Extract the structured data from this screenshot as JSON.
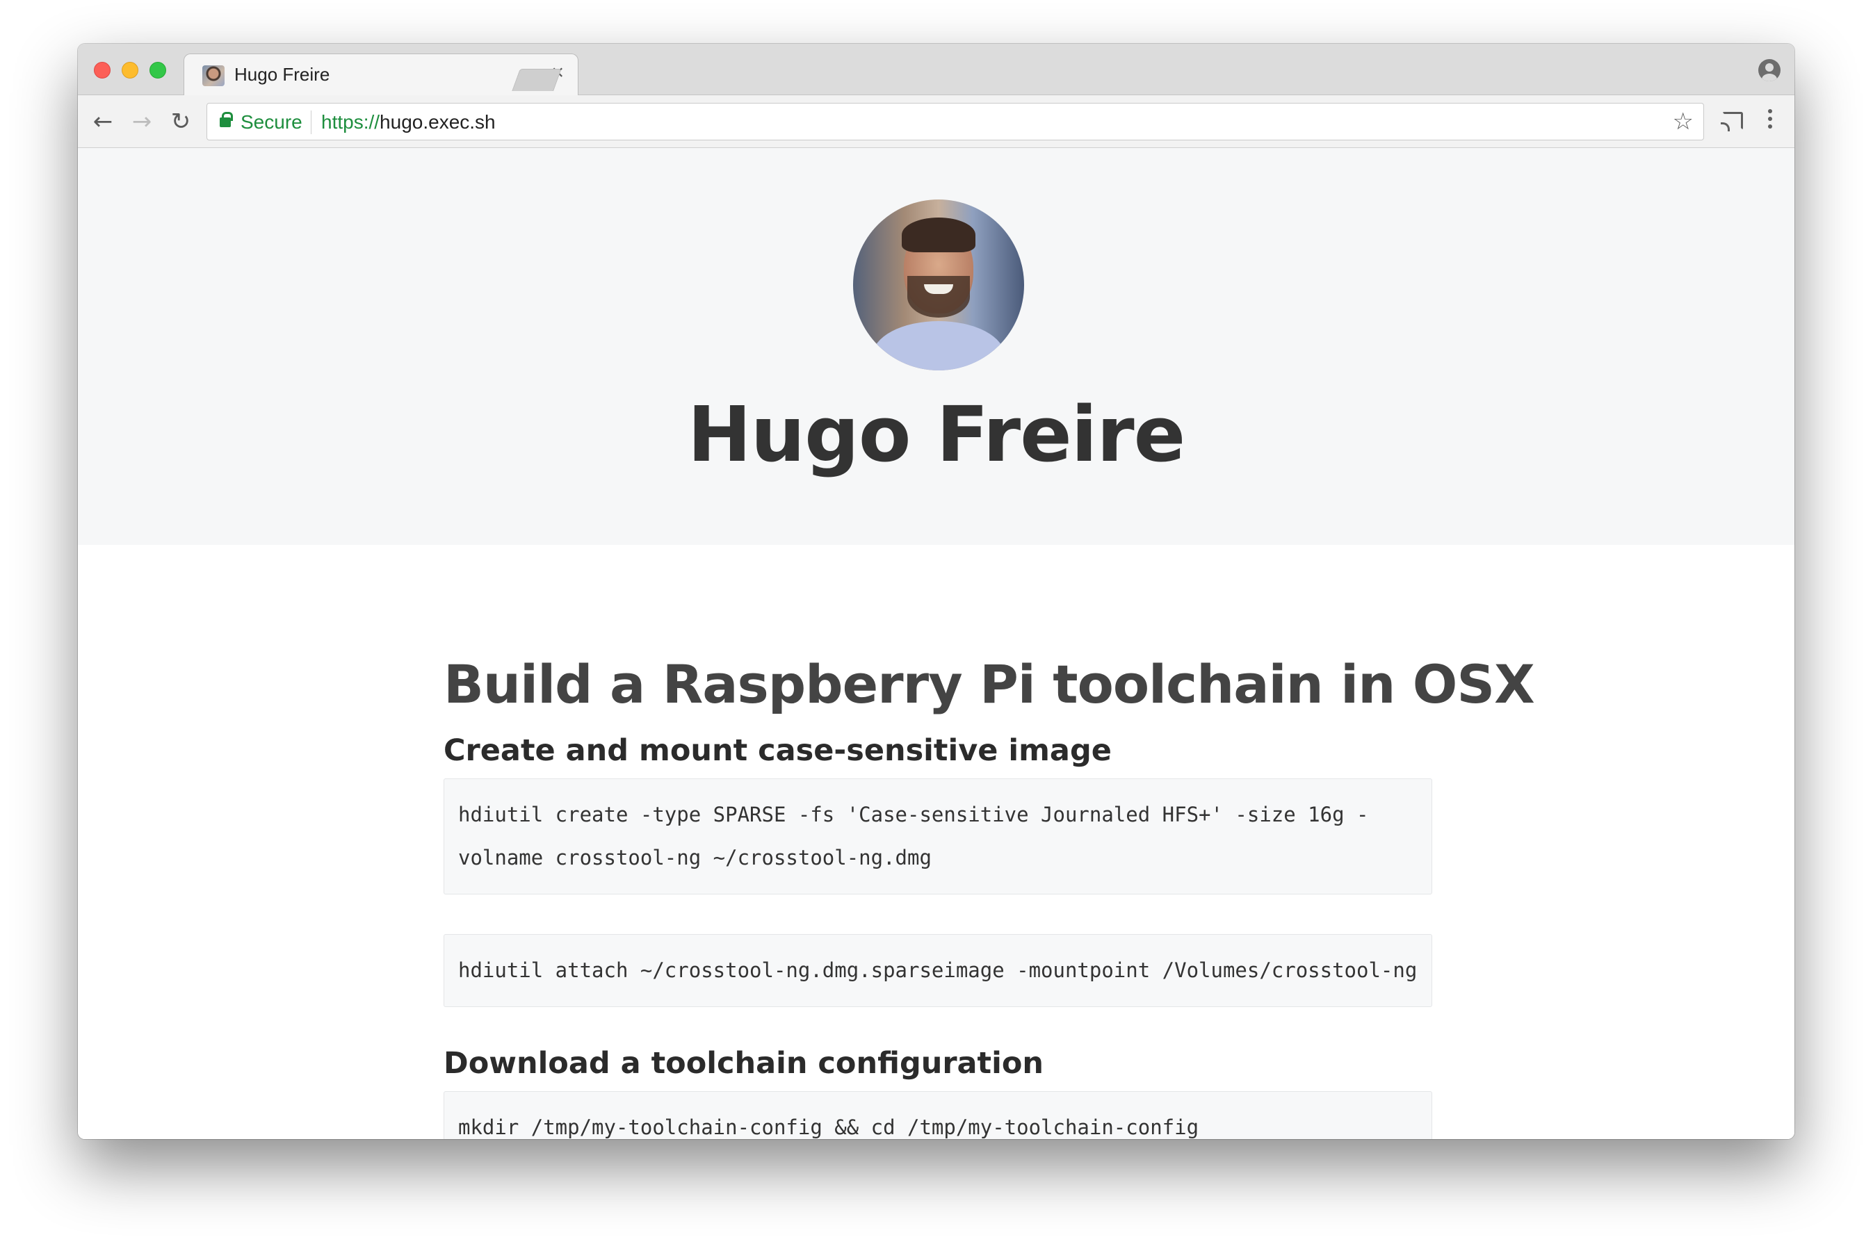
{
  "browser": {
    "tab_title": "Hugo Freire",
    "secure_label": "Secure",
    "url_scheme": "https://",
    "url_host": "hugo.exec.sh",
    "icons": {
      "back": "arrow-left-icon",
      "forward": "arrow-right-icon",
      "reload": "reload-icon",
      "lock": "lock-icon",
      "bookmark": "star-icon",
      "cast": "cast-icon",
      "menu": "kebab-menu-icon",
      "profile": "profile-icon",
      "close_tab": "close-icon"
    }
  },
  "hero": {
    "name": "Hugo Freire"
  },
  "article": {
    "title": "Build a Raspberry Pi toolchain in OSX",
    "sections": [
      {
        "heading": "Create and mount case-sensitive image",
        "code": [
          "hdiutil create -type SPARSE -fs 'Case-sensitive Journaled HFS+' -size 16g -volname crosstool-ng ~/crosstool-ng.dmg",
          "hdiutil attach ~/crosstool-ng.dmg.sparseimage -mountpoint /Volumes/crosstool-ng"
        ]
      },
      {
        "heading": "Download a toolchain configuration",
        "code": [
          "mkdir /tmp/my-toolchain-config && cd /tmp/my-toolchain-config"
        ]
      }
    ]
  },
  "colors": {
    "secure_green": "#1e8e3e",
    "hero_bg": "#f6f7f8",
    "code_bg": "#f7f8f9"
  }
}
